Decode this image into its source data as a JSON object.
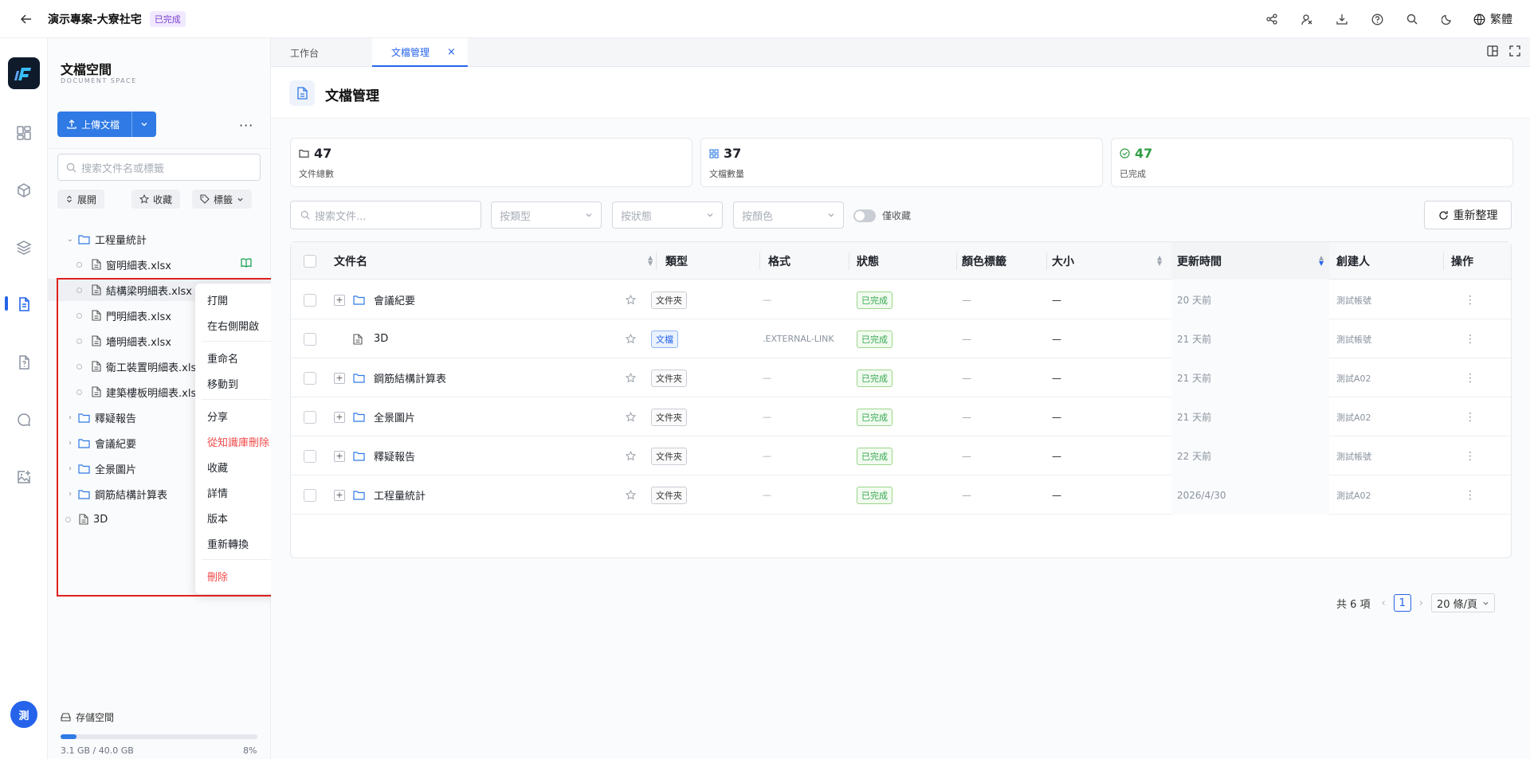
{
  "header": {
    "title": "演示專案-大寮社宅",
    "badge": "已完成",
    "lang": "繁體"
  },
  "sidebar": {
    "title": "文檔空間",
    "subtitle": "DOCUMENT SPACE",
    "upload_label": "上傳文檔",
    "search_placeholder": "搜索文件名或標籤",
    "expand_label": "展開",
    "fav_label": "收藏",
    "tags_label": "標籤",
    "tree": [
      {
        "label": "工程量統計",
        "kind": "folder",
        "level": 0,
        "expanded": true
      },
      {
        "label": "窗明細表.xlsx",
        "kind": "file",
        "level": 1
      },
      {
        "label": "結構梁明細表.xlsx",
        "kind": "file",
        "level": 1
      },
      {
        "label": "門明細表.xlsx",
        "kind": "file",
        "level": 1
      },
      {
        "label": "墻明細表.xlsx",
        "kind": "file",
        "level": 1
      },
      {
        "label": "衛工裝置明細表.xlsx",
        "kind": "file",
        "level": 1
      },
      {
        "label": "建築樓板明細表.xlsx",
        "kind": "file",
        "level": 1
      },
      {
        "label": "釋疑報告",
        "kind": "folder",
        "level": 0
      },
      {
        "label": "會議紀要",
        "kind": "folder",
        "level": 0
      },
      {
        "label": "全景圖片",
        "kind": "folder",
        "level": 0
      },
      {
        "label": "鋼筋結構計算表",
        "kind": "folder",
        "level": 0
      },
      {
        "label": "3D",
        "kind": "file",
        "level": 0
      }
    ],
    "storage": {
      "label": "存儲空間",
      "amount": "3.1 GB / 40.0 GB",
      "percent": "8%",
      "fraction": 0.08
    }
  },
  "context_menu": {
    "items": [
      "打開",
      "在右側開啟",
      "重命名",
      "移動到",
      "分享",
      "從知識庫刪除",
      "收藏",
      "詳情",
      "版本",
      "重新轉換",
      "刪除"
    ]
  },
  "tabs": {
    "items": [
      "工作台",
      "文檔管理"
    ]
  },
  "page": {
    "title": "文檔管理"
  },
  "stats": [
    {
      "value": "47",
      "label": "文件總數",
      "color": "#1f2329"
    },
    {
      "value": "37",
      "label": "文檔數量",
      "color": "#1f2329"
    },
    {
      "value": "47",
      "label": "已完成",
      "color": "#2f9e44"
    }
  ],
  "filters": {
    "search_placeholder": "搜索文件...",
    "type": "按類型",
    "status": "按狀態",
    "color": "按顏色",
    "fav_only": "僅收藏",
    "reorg": "重新整理"
  },
  "table": {
    "headers": {
      "name": "文件名",
      "type": "類型",
      "format": "格式",
      "status": "狀態",
      "color_tag": "顏色標籤",
      "size": "大小",
      "updated": "更新時間",
      "creator": "創建人",
      "ops": "操作"
    },
    "rows": [
      {
        "name": "會議紀要",
        "folder": true,
        "type": "文件夾",
        "format": "—",
        "status": "已完成",
        "color": "—",
        "size": "—",
        "updated": "20 天前",
        "creator": "測試帳號"
      },
      {
        "name": "3D",
        "folder": false,
        "type": "文檔",
        "format": ".EXTERNAL-LINK",
        "status": "已完成",
        "color": "—",
        "size": "—",
        "updated": "21 天前",
        "creator": "測試帳號"
      },
      {
        "name": "鋼筋結構計算表",
        "folder": true,
        "type": "文件夾",
        "format": "—",
        "status": "已完成",
        "color": "—",
        "size": "—",
        "updated": "21 天前",
        "creator": "測試A02"
      },
      {
        "name": "全景圖片",
        "folder": true,
        "type": "文件夾",
        "format": "—",
        "status": "已完成",
        "color": "—",
        "size": "—",
        "updated": "21 天前",
        "creator": "測試A02"
      },
      {
        "name": "釋疑報告",
        "folder": true,
        "type": "文件夾",
        "format": "—",
        "status": "已完成",
        "color": "—",
        "size": "—",
        "updated": "22 天前",
        "creator": "測試帳號"
      },
      {
        "name": "工程量統計",
        "folder": true,
        "type": "文件夾",
        "format": "—",
        "status": "已完成",
        "color": "—",
        "size": "—",
        "updated": "2026/4/30",
        "creator": "測試A02"
      }
    ]
  },
  "pagination": {
    "total": "共 6 項",
    "page": "1",
    "per_page": "20 條/頁"
  },
  "user": {
    "avatar": "測"
  }
}
